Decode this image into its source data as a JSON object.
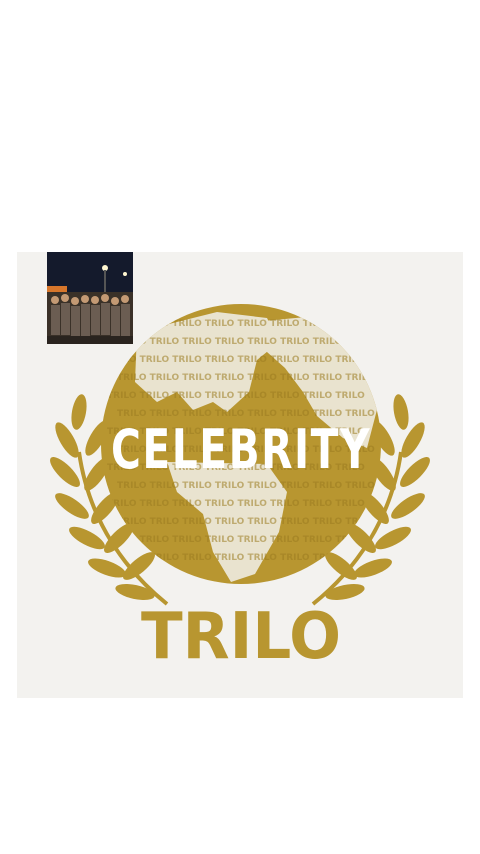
{
  "logo": {
    "headline": "CELEBRITY",
    "brand": "TRILO",
    "pattern_word": "TRILO",
    "colors": {
      "gold": "#b89630",
      "gold_dark": "#9c7d22",
      "card_background": "#f3f2ef",
      "page_background": "#ffffff"
    }
  },
  "thumbnail": {
    "icon": "crowd-photo"
  }
}
